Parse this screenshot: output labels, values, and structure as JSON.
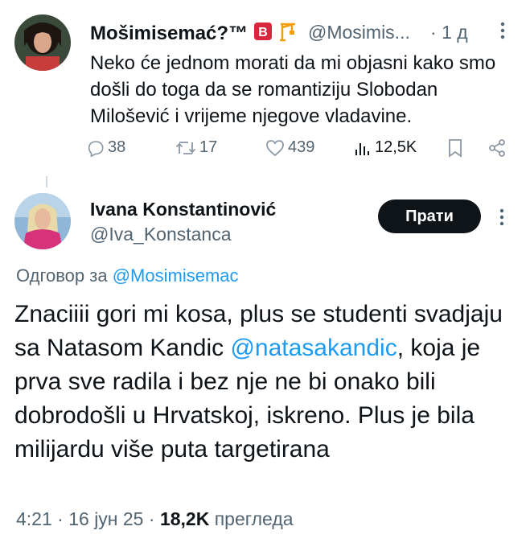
{
  "tweet": {
    "author_name": "Mošimisemać?™",
    "handle": "@Mosimis...",
    "separator": "·",
    "time": "1 д",
    "text": "Neko će jednom morati da mi objasni kako smo došli do toga da se romantiziju Slobodan Milošević i vrijeme njegove vladavine.",
    "stats": {
      "replies": "38",
      "retweets": "17",
      "likes": "439",
      "views": "12,5K"
    },
    "colors": {
      "badge_red": "#d7263d",
      "crane_orange": "#f59e0b"
    }
  },
  "reply": {
    "author_name": "Ivana Konstantinović",
    "handle": "@Iva_Konstanca",
    "follow_label": "Прати",
    "reply_prefix": "Одговор за",
    "reply_to": "@Mosimisemac",
    "text_part1": "Znaciiii gori mi kosa, plus se studenti svadjaju sa Natasom Kandic ",
    "mention": "@natasakandic",
    "text_part2": ", koja je prva sve radila i bez nje ne bi onako bili dobrodošli u Hrvatskoj, iskreno. Plus je bila milijardu više puta targetirana",
    "time": "4:21",
    "date": "16 јун 25",
    "views_count": "18,2K",
    "views_label": "прегледа",
    "separator": "·"
  },
  "colors": {
    "text": "#0f1419",
    "muted": "#536471",
    "link": "#1d9bf0",
    "button_bg": "#0f1419"
  }
}
